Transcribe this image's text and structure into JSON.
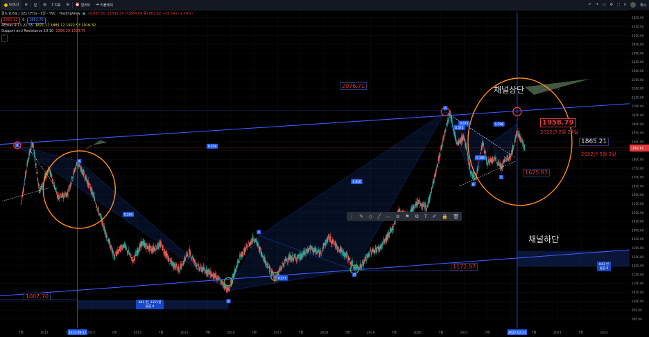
{
  "topbar": {
    "symbol": "GOLD",
    "interval": "일",
    "indicators_label": "지표",
    "alert_label": "얼러트",
    "replay_label": "리플레이",
    "publish_label": "게시"
  },
  "legend": {
    "title": "골드 (US$ / OZ) CFDs · 1일 · TVC · TradingView",
    "ohlc": "시1887.00 고1895.34 저1864.60 종1862.62 −23.54 (−1.74%)",
    "price_sell": "1862.62",
    "price_buy": "1862.70",
    "ma_label": "4Emas 9 13 21 55",
    "ma_values": "1871.17 1885.12 1922.53 1916.32",
    "sr_label": "Support and Resistance 10 10",
    "sr_values": "1956.29 1590.75",
    "colors": {
      "sell": "#e5383b",
      "buy": "#2962ff",
      "ma1": "#e5383b",
      "ma2": "#ff9800",
      "ma3": "#ffeb3b",
      "ma4": "#ffffff"
    }
  },
  "annotations": {
    "upper_channel": "채널상단",
    "lower_channel": "채널하단",
    "peak_price": "1958.79",
    "peak_date": "2022년 2월 24일",
    "current_price": "1865.21",
    "current_date": "2022년 5월 3일",
    "high_2020": "2076.71",
    "low_2015": "1007.70",
    "low_2018": "1172.97",
    "low_2021": "1675.83",
    "range_box_1": "843 번, 1151일",
    "range_box_1b": "볼륨 0",
    "range_box_2": "843 번",
    "range_box_2b": "볼륨 0",
    "ratios": [
      "0.378",
      "0.266",
      "0.856",
      "0.577",
      "0.388",
      "0.572",
      "0.673",
      "0.798"
    ],
    "points": [
      "X",
      "A",
      "B",
      "C",
      "D",
      "A",
      "B",
      "C"
    ]
  },
  "chart_data": {
    "type": "line",
    "title": "골드 (US$ / OZ) CFDs · 1일 · TVC · TradingView",
    "x_tick_labels": [
      "7월",
      "2012",
      "7월",
      "2013",
      "7월",
      "2014",
      "7월",
      "2015",
      "7월",
      "2016",
      "7월",
      "2017",
      "7월",
      "2018",
      "7월",
      "2019",
      "7월",
      "2020",
      "7월",
      "2021",
      "7월",
      "2022",
      "7월",
      "2023",
      "7월",
      "2024"
    ],
    "y_tick_labels": [
      "2600.00",
      "2550.00",
      "2500.00",
      "2450.00",
      "2400.00",
      "2350.00",
      "2300.00",
      "2250.00",
      "2200.00",
      "2150.00",
      "2100.00",
      "2050.00",
      "2000.00",
      "1950.00",
      "1900.00",
      "1850.00",
      "1800.00",
      "1750.00",
      "1700.00",
      "1650.00",
      "1600.00",
      "1550.00",
      "1500.00",
      "1450.00",
      "1400.00",
      "1350.00",
      "1300.00",
      "1250.00",
      "1200.00",
      "1150.00",
      "1100.00",
      "1050.00",
      "1000.00",
      "950.00",
      "900.00"
    ],
    "ylim": [
      880,
      2630
    ],
    "date_marks": [
      "2012-09-17",
      "2022-02-21"
    ],
    "x": [
      2011.5,
      2011.65,
      2011.75,
      2011.9,
      2012.1,
      2012.3,
      2012.5,
      2012.7,
      2012.85,
      2013.05,
      2013.3,
      2013.5,
      2013.7,
      2013.9,
      2014.1,
      2014.3,
      2014.5,
      2014.7,
      2014.9,
      2015.1,
      2015.3,
      2015.5,
      2015.8,
      2015.95,
      2016.2,
      2016.5,
      2016.75,
      2016.95,
      2017.2,
      2017.5,
      2017.7,
      2017.9,
      2018.1,
      2018.3,
      2018.5,
      2018.65,
      2018.8,
      2019.0,
      2019.2,
      2019.45,
      2019.6,
      2019.8,
      2020.0,
      2020.2,
      2020.4,
      2020.6,
      2020.7,
      2020.85,
      2021.0,
      2021.15,
      2021.25,
      2021.4,
      2021.5,
      2021.65,
      2021.8,
      2021.9,
      2022.0,
      2022.15,
      2022.3
    ],
    "y": [
      1550,
      1800,
      1900,
      1620,
      1750,
      1580,
      1610,
      1780,
      1720,
      1600,
      1400,
      1250,
      1320,
      1230,
      1330,
      1290,
      1320,
      1220,
      1180,
      1280,
      1190,
      1170,
      1110,
      1060,
      1250,
      1360,
      1220,
      1130,
      1240,
      1250,
      1300,
      1270,
      1360,
      1300,
      1250,
      1190,
      1200,
      1280,
      1300,
      1400,
      1510,
      1480,
      1560,
      1520,
      1730,
      1970,
      2070,
      1880,
      1930,
      1720,
      1690,
      1900,
      1780,
      1800,
      1760,
      1800,
      1820,
      1960,
      1865
    ]
  }
}
